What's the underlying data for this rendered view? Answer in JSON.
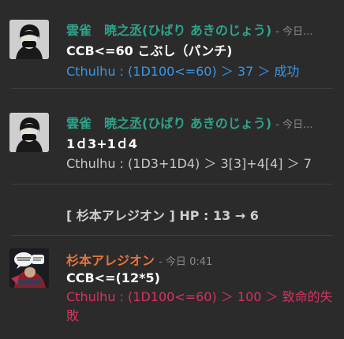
{
  "messages": [
    {
      "author": "雲雀　暁之丞(ひばり あきのじょう)",
      "timestamp": "- 今日...",
      "command": "CCB<=60 こぶし（パンチ)",
      "result": "Cthulhu : (1D100<=60) ＞ 37 ＞ 成功"
    },
    {
      "author": "雲雀　暁之丞(ひばり あきのじょう)",
      "timestamp": "- 今日...",
      "command": "1ｄ3+1ｄ4",
      "result": "Cthulhu : (1D3+1D4) ＞ 3[3]+4[4] ＞ 7"
    },
    {
      "system": "[ 杉本アレジオン ] HP : 13 → 6"
    },
    {
      "author": "杉本アレジオン",
      "timestamp": "- 今日 0:41",
      "command": "CCB<=(12*5)",
      "result": "Cthulhu : (1D100<=60) ＞ 100 ＞ 致命的失敗"
    }
  ],
  "colors": {
    "teal_author": "#2fa38a",
    "orange_author": "#e8743b",
    "success": "#3b97e6",
    "fumble": "#d9325f",
    "background": "#2b2b2b"
  }
}
